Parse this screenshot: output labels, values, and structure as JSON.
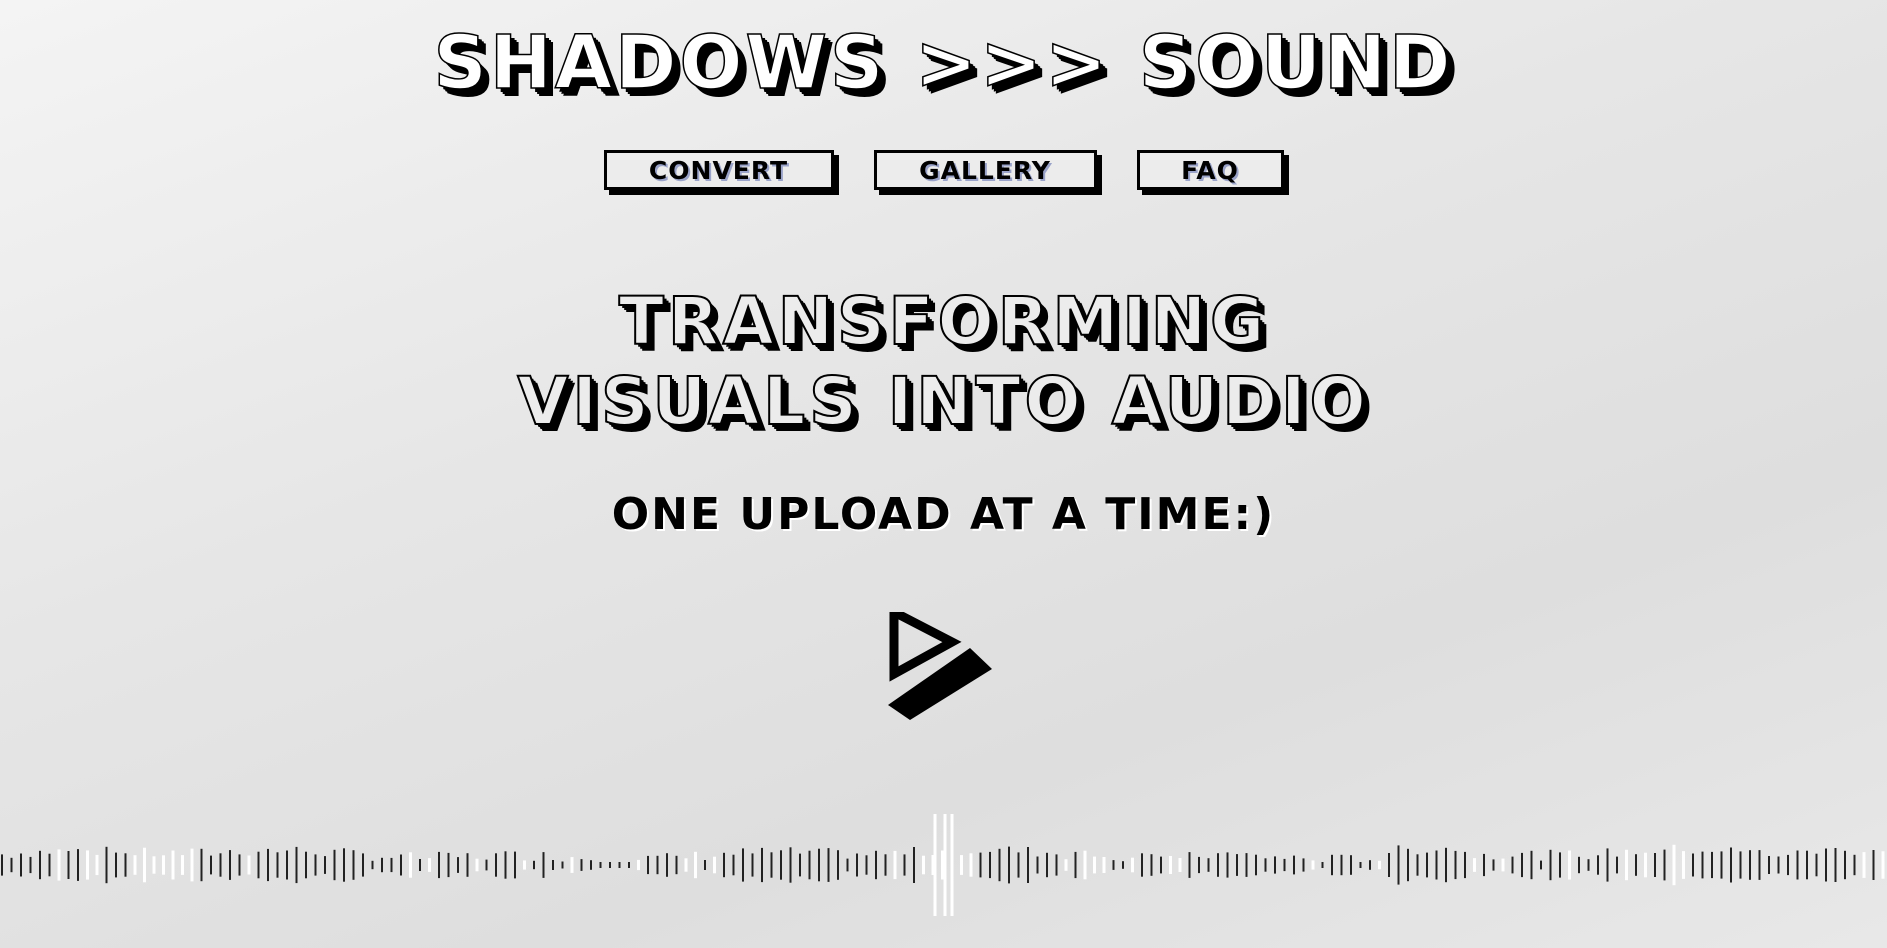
{
  "header": {
    "title": "SHADOWS >>> SOUND"
  },
  "nav": {
    "items": [
      {
        "label": "CONVERT"
      },
      {
        "label": "GALLERY"
      },
      {
        "label": "FAQ"
      }
    ]
  },
  "hero": {
    "headline_line1": "TRANSFORMING",
    "headline_line2": "VISUALS INTO AUDIO",
    "subline": "ONE UPLOAD AT A TIME:)"
  },
  "play_button": {
    "icon": "play-icon"
  },
  "waveform": {
    "icon": "audio-waveform",
    "colors": {
      "dark": "#222222",
      "light": "#ffffff"
    }
  }
}
